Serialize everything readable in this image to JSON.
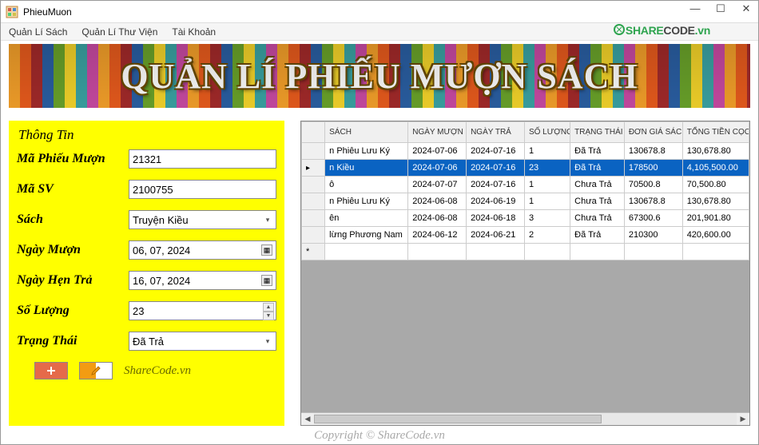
{
  "window": {
    "title": "PhieuMuon"
  },
  "menu": {
    "items": [
      "Quản Lí Sách",
      "Quản Lí Thư Viện",
      "Tài Khoản"
    ]
  },
  "brand": {
    "share": "SHARE",
    "code": "CODE",
    "tld": ".vn"
  },
  "banner": {
    "text": "QUẢN LÍ PHIẾU MƯỢN SÁCH"
  },
  "form": {
    "title": "Thông Tin",
    "labels": {
      "ma_pm": "Mã Phiếu Mượn",
      "ma_sv": "Mã SV",
      "sach": "Sách",
      "ngay_muon": "Ngày Mượn",
      "ngay_tra": "Ngày Hẹn Trả",
      "so_luong": "Số Lượng",
      "trang_thai": "Trạng Thái"
    },
    "values": {
      "ma_pm": "21321",
      "ma_sv": "2100755",
      "sach": "Truyện Kiều",
      "ngay_muon": "06, 07, 2024",
      "ngay_tra": "16, 07, 2024",
      "so_luong": "23",
      "trang_thai": "Đã Trả"
    },
    "watermark": "ShareCode.vn"
  },
  "grid": {
    "headers": [
      "",
      "SÁCH",
      "NGÀY MƯỢN",
      "NGÀY TRẢ",
      "SỐ LƯỢNG",
      "TRẠNG THÁI",
      "ĐƠN GIÁ SÁCH",
      "TỔNG TIỀN CỌC"
    ],
    "rows": [
      {
        "sel": false,
        "cells": [
          "n Phiêu Lưu Ký",
          "2024-07-06",
          "2024-07-16",
          "1",
          "Đã Trả",
          "130678.8",
          "130,678.80"
        ]
      },
      {
        "sel": true,
        "cells": [
          "n Kiều",
          "2024-07-06",
          "2024-07-16",
          "23",
          "Đã Trả",
          "178500",
          "4,105,500.00"
        ]
      },
      {
        "sel": false,
        "cells": [
          "ô",
          "2024-07-07",
          "2024-07-16",
          "1",
          "Chưa Trả",
          "70500.8",
          "70,500.80"
        ]
      },
      {
        "sel": false,
        "cells": [
          "n Phiêu Lưu Ký",
          "2024-06-08",
          "2024-06-19",
          "1",
          "Chưa Trả",
          "130678.8",
          "130,678.80"
        ]
      },
      {
        "sel": false,
        "cells": [
          "ên",
          "2024-06-08",
          "2024-06-18",
          "3",
          "Chưa Trả",
          "67300.6",
          "201,901.80"
        ]
      },
      {
        "sel": false,
        "cells": [
          "lừng Phương Nam",
          "2024-06-12",
          "2024-06-21",
          "2",
          "Đã Trả",
          "210300",
          "420,600.00"
        ]
      }
    ]
  },
  "footer": {
    "copyright": "Copyright © ShareCode.vn"
  }
}
